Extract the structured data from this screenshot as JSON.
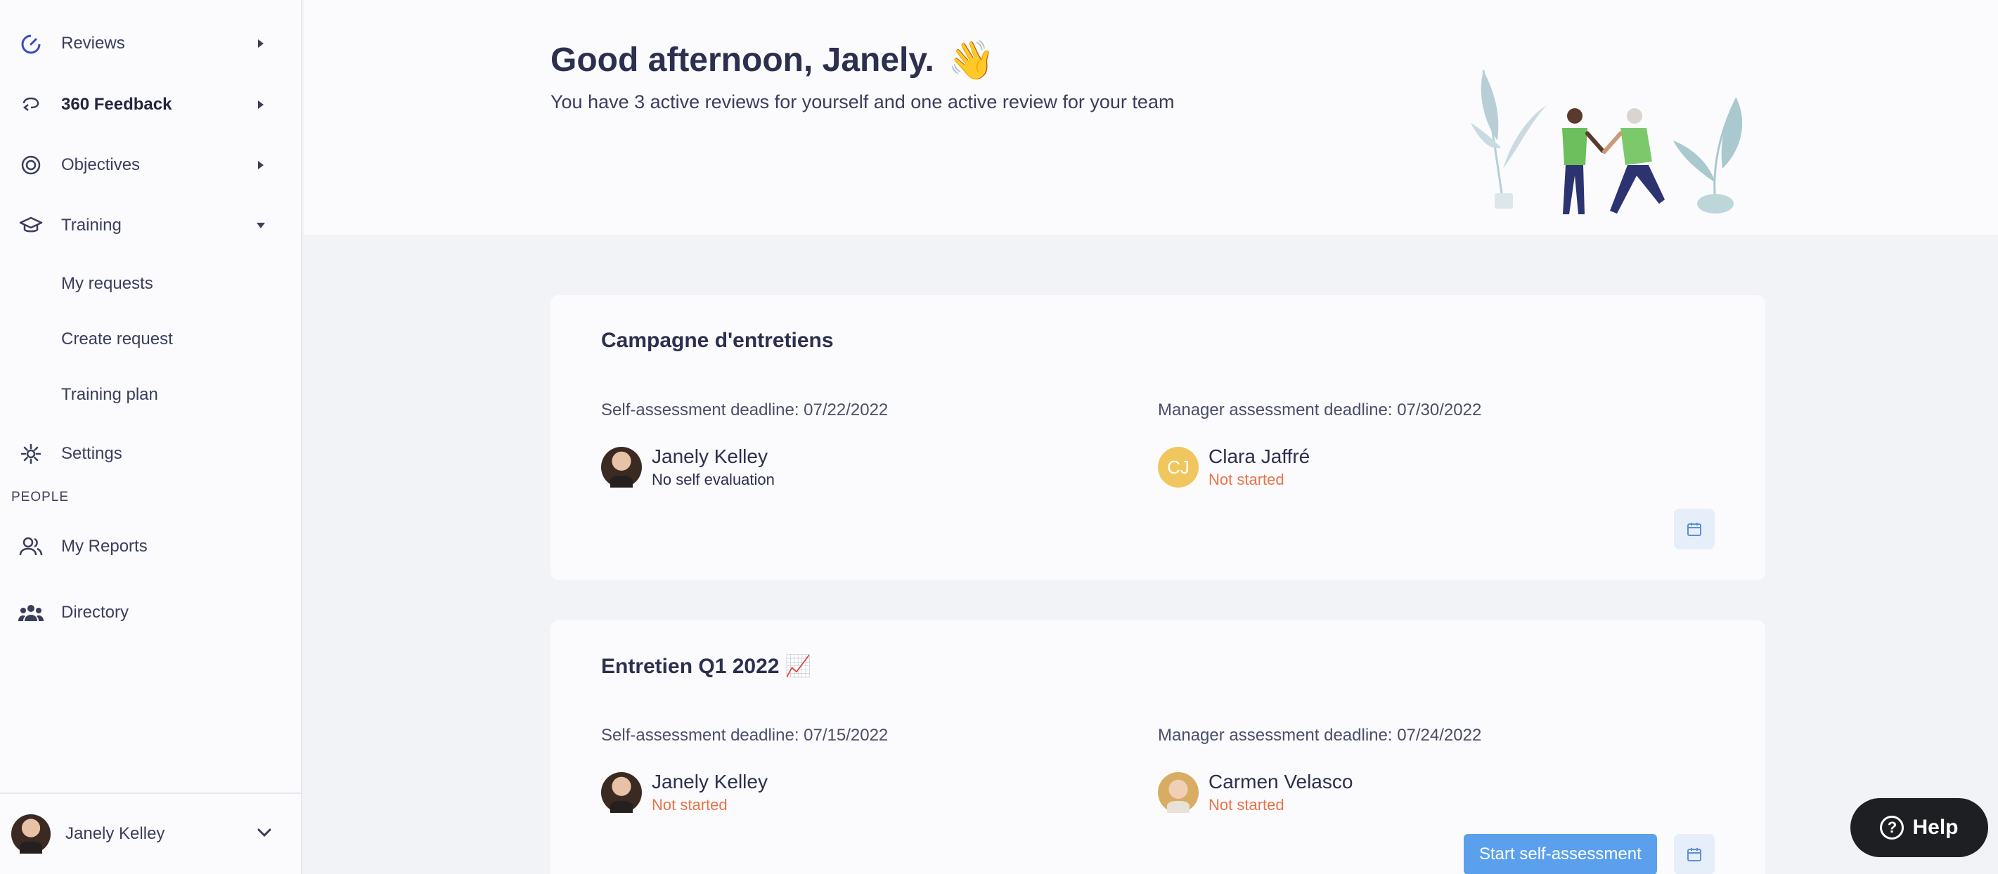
{
  "sidebar": {
    "items": [
      {
        "label": "Reviews",
        "icon": "gauge-icon"
      },
      {
        "label": "360 Feedback",
        "icon": "feedback-loop-icon"
      },
      {
        "label": "Objectives",
        "icon": "target-icon"
      },
      {
        "label": "Training",
        "icon": "graduation-cap-icon"
      }
    ],
    "training_sub": [
      "My requests",
      "Create request",
      "Training plan"
    ],
    "settings_label": "Settings",
    "people_section": "PEOPLE",
    "my_reports_label": "My Reports",
    "directory_label": "Directory",
    "user_name": "Janely Kelley"
  },
  "header": {
    "greeting": "Good afternoon, Janely.",
    "wave_emoji": "👋",
    "subtitle": "You have 3 active reviews for yourself and one active review for your team"
  },
  "cards": [
    {
      "title": "Campagne d'entretiens",
      "self_deadline": "Self-assessment deadline: 07/22/2022",
      "manager_deadline": "Manager assessment deadline: 07/30/2022",
      "self_person": {
        "name": "Janely Kelley",
        "status": "No self evaluation"
      },
      "manager_person": {
        "name": "Clara Jaffré",
        "status": "Not started",
        "initials": "CJ"
      }
    },
    {
      "title": "Entretien Q1 2022 📈",
      "self_deadline": "Self-assessment deadline: 07/15/2022",
      "manager_deadline": "Manager assessment deadline: 07/24/2022",
      "self_person": {
        "name": "Janely Kelley",
        "status": "Not started"
      },
      "manager_person": {
        "name": "Carmen Velasco",
        "status": "Not started"
      },
      "action_label": "Start self-assessment"
    }
  ],
  "help_label": "Help",
  "colors": {
    "accent": "#5ba0ec",
    "status_orange": "#e8734a",
    "initials_bg": "#f0c75e"
  }
}
